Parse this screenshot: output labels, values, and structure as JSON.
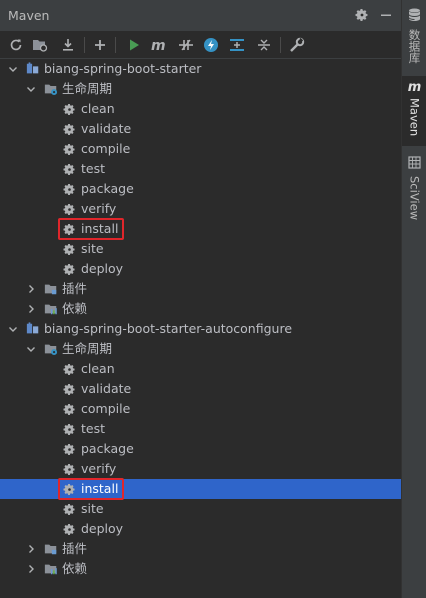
{
  "panel": {
    "title": "Maven",
    "header_icons": [
      "gear-icon",
      "minimize-icon"
    ]
  },
  "toolbar": {
    "buttons": [
      "reload-all-icon",
      "reload-folder-icon",
      "download-sources-icon",
      "add-project-icon",
      "run-icon",
      "maven-goal-icon",
      "toggle-offline-icon",
      "skip-tests-icon",
      "show-dependencies-icon",
      "expand-all-icon",
      "collapse-all-icon",
      "settings-wrench-icon"
    ]
  },
  "tree": {
    "projects": [
      {
        "name": "biang-spring-boot-starter",
        "lifecycle_label": "生命周期",
        "goals": [
          "clean",
          "validate",
          "compile",
          "test",
          "package",
          "verify",
          "install",
          "site",
          "deploy"
        ],
        "plugins_label": "插件",
        "dependencies_label": "依赖"
      },
      {
        "name": "biang-spring-boot-starter-autoconfigure",
        "lifecycle_label": "生命周期",
        "goals": [
          "clean",
          "validate",
          "compile",
          "test",
          "package",
          "verify",
          "install",
          "site",
          "deploy"
        ],
        "plugins_label": "插件",
        "dependencies_label": "依赖"
      }
    ],
    "selected": "install (biang-spring-boot-starter-autoconfigure)"
  },
  "sidebar": {
    "tabs": [
      {
        "label": "数据库",
        "icon": "database-icon",
        "active": false
      },
      {
        "label": "Maven",
        "icon": "maven-icon",
        "active": true
      },
      {
        "label": "SciView",
        "icon": "sciview-icon",
        "active": false
      }
    ]
  },
  "colors": {
    "selection": "#2f65ca",
    "highlight_box": "#e0262b",
    "run_green": "#499c54",
    "accent_blue": "#3592c4"
  }
}
